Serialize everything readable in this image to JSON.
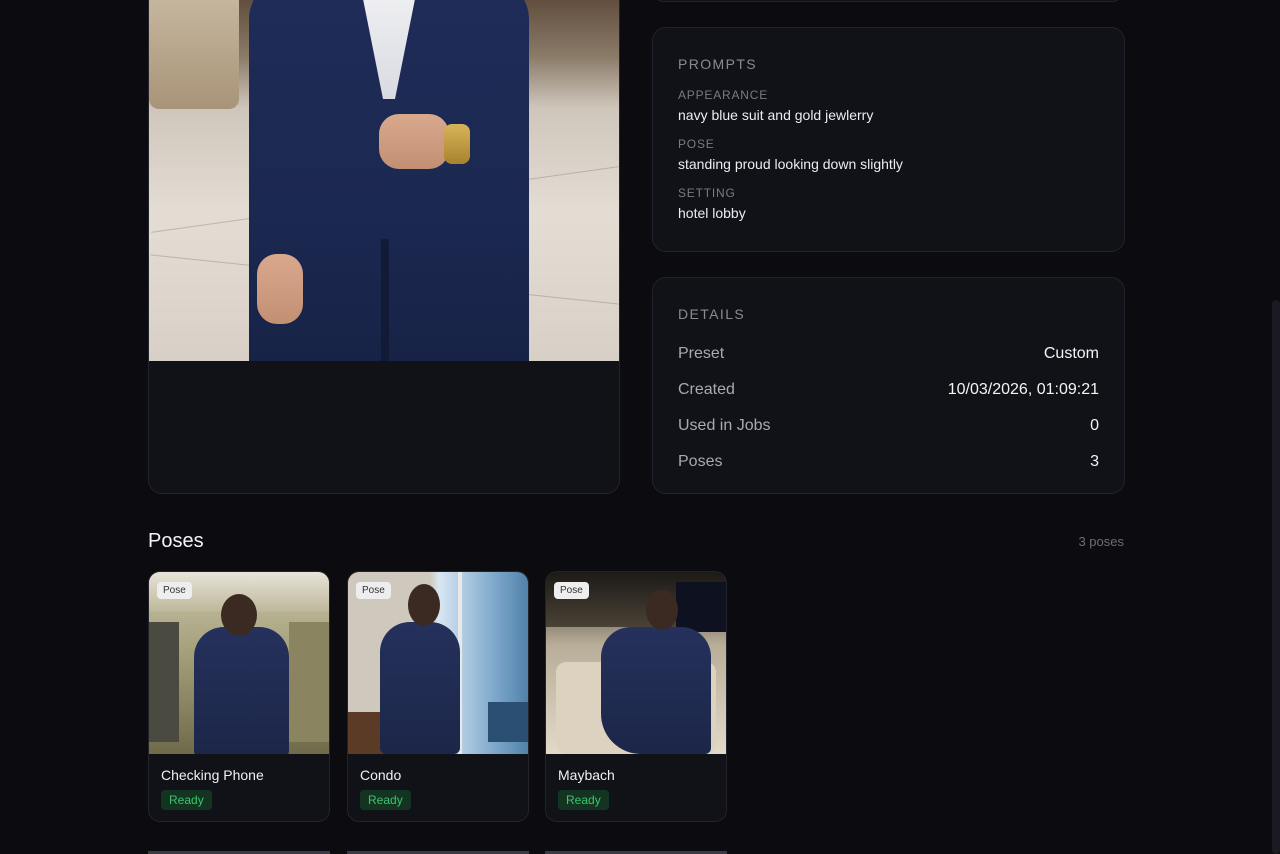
{
  "prompts": {
    "title": "PROMPTS",
    "items": [
      {
        "label": "APPEARANCE",
        "value": "navy blue suit and gold jewlerry"
      },
      {
        "label": "POSE",
        "value": "standing proud looking down slightly"
      },
      {
        "label": "SETTING",
        "value": "hotel lobby"
      }
    ]
  },
  "details": {
    "title": "DETAILS",
    "rows": [
      {
        "key": "Preset",
        "value": "Custom"
      },
      {
        "key": "Created",
        "value": "10/03/2026, 01:09:21"
      },
      {
        "key": "Used in Jobs",
        "value": "0"
      },
      {
        "key": "Poses",
        "value": "3"
      }
    ]
  },
  "poses": {
    "title": "Poses",
    "count": "3 poses",
    "items": [
      {
        "badge": "Pose",
        "name": "Checking Phone",
        "status": "Ready"
      },
      {
        "badge": "Pose",
        "name": "Condo",
        "status": "Ready"
      },
      {
        "badge": "Pose",
        "name": "Maybach",
        "status": "Ready"
      }
    ]
  },
  "colors": {
    "background": "#0b0b10",
    "card": "#111118",
    "ready": "#3ec46d"
  }
}
